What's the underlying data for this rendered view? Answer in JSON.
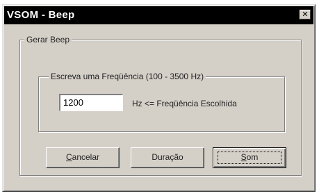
{
  "window": {
    "title": "VSOM - Beep",
    "close_glyph": "✕"
  },
  "group_outer": {
    "label": "Gerar Beep"
  },
  "group_inner": {
    "label": "Escreva uma Freqüência (100 - 3500 Hz)"
  },
  "frequency_input": {
    "value": "1200"
  },
  "hint_text": "Hz <= Freqüência Escolhida",
  "buttons": {
    "cancel": {
      "mnemonic": "C",
      "rest": "ancelar"
    },
    "duration": {
      "label": "Duração"
    },
    "sound": {
      "mnemonic": "S",
      "rest": "om"
    }
  },
  "icons": {
    "close": "close-icon"
  }
}
